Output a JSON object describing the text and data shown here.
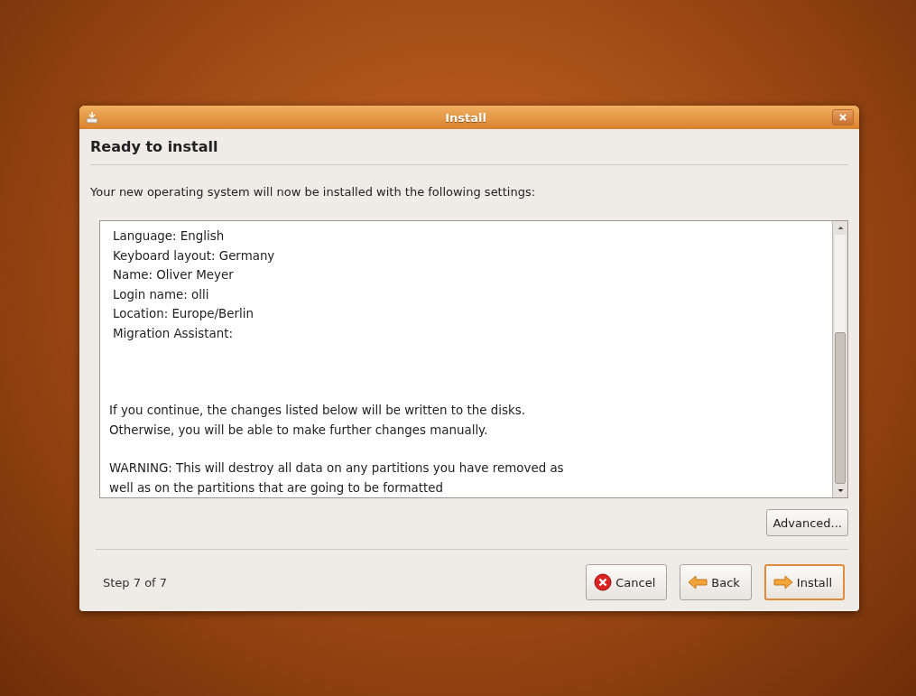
{
  "window": {
    "title": "Install"
  },
  "heading": "Ready to install",
  "intro": "Your new operating system will now be installed with the following settings:",
  "summary": {
    "settings": [
      "Language: English",
      "Keyboard layout: Germany",
      "Name: Oliver Meyer",
      "Login name: olli",
      "Location: Europe/Berlin",
      "Migration Assistant:"
    ],
    "notes": [
      "If you continue, the changes listed below will be written to the disks.\nOtherwise, you will be able to make further changes manually.",
      "WARNING: This will destroy all data on any partitions you have removed as\nwell as on the partitions that are going to be formatted"
    ]
  },
  "advanced_button": "Advanced...",
  "step": "Step 7 of 7",
  "buttons": [
    {
      "kind": "cancel",
      "label": "Cancel",
      "default": false
    },
    {
      "kind": "back",
      "label": "Back",
      "default": false
    },
    {
      "kind": "install",
      "label": "Install",
      "default": true
    }
  ]
}
